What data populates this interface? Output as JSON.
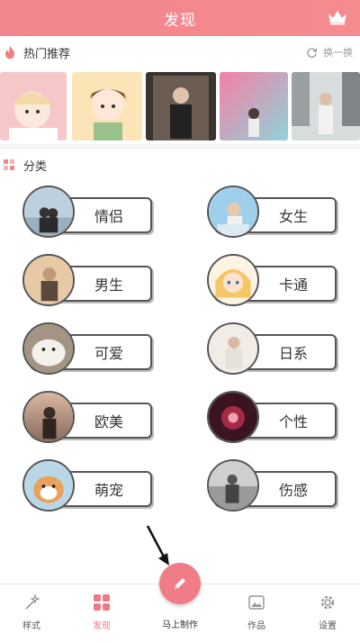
{
  "header": {
    "title": "发现"
  },
  "hot": {
    "label": "热门推荐",
    "refresh_label": "换一换",
    "thumbs": [
      "cartoon-girl-thumb",
      "cartoon-boy-thumb",
      "mirror-selfie-thumb",
      "pink-neon-thumb",
      "street-girl-thumb"
    ]
  },
  "categories": {
    "label": "分类",
    "items": [
      {
        "name": "情侣",
        "key": "couple"
      },
      {
        "name": "女生",
        "key": "girl"
      },
      {
        "name": "男生",
        "key": "boy"
      },
      {
        "name": "卡通",
        "key": "cartoon"
      },
      {
        "name": "可爱",
        "key": "cute"
      },
      {
        "name": "日系",
        "key": "japanese"
      },
      {
        "name": "欧美",
        "key": "western"
      },
      {
        "name": "个性",
        "key": "personality"
      },
      {
        "name": "萌宠",
        "key": "pet"
      },
      {
        "name": "伤感",
        "key": "sad"
      }
    ]
  },
  "tabbar": {
    "tabs": [
      {
        "label": "样式",
        "icon": "wand-icon"
      },
      {
        "label": "发现",
        "icon": "grid-icon",
        "active": true
      },
      {
        "label": "作品",
        "icon": "gallery-icon"
      },
      {
        "label": "设置",
        "icon": "gear-icon"
      }
    ],
    "fab_label": "马上制作",
    "fab_icon": "pencil-icon"
  },
  "colors": {
    "accent": "#f07c87",
    "header": "#f3858e",
    "active_tab": "#ef7a85"
  }
}
